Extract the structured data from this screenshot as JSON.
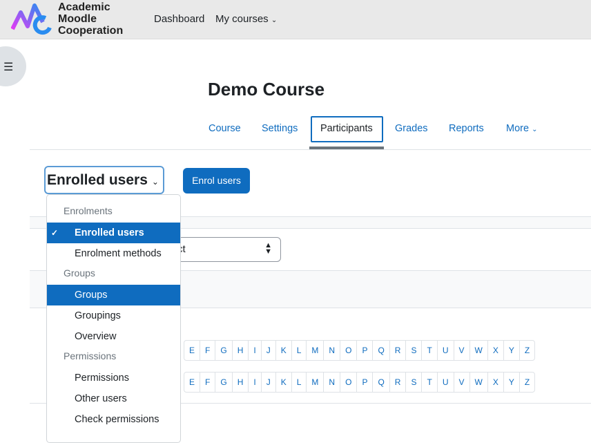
{
  "header": {
    "brand": [
      "Academic",
      "Moodle",
      "Cooperation"
    ],
    "nav": [
      "Dashboard",
      "My courses"
    ]
  },
  "course": {
    "title": "Demo Course"
  },
  "tabs": [
    "Course",
    "Settings",
    "Participants",
    "Grades",
    "Reports",
    "More"
  ],
  "selected_tab": "Participants",
  "page_select": {
    "value": "Enrolled users"
  },
  "enrol_button": "Enrol users",
  "filter_select": {
    "partial_value": "ct"
  },
  "letters": [
    "E",
    "F",
    "G",
    "H",
    "I",
    "J",
    "K",
    "L",
    "M",
    "N",
    "O",
    "P",
    "Q",
    "R",
    "S",
    "T",
    "U",
    "V",
    "W",
    "X",
    "Y",
    "Z"
  ],
  "dropdown": [
    {
      "type": "header",
      "label": "Enrolments"
    },
    {
      "type": "item",
      "label": "Enrolled users",
      "selected": true
    },
    {
      "type": "item",
      "label": "Enrolment methods"
    },
    {
      "type": "header",
      "label": "Groups"
    },
    {
      "type": "item",
      "label": "Groups",
      "highlighted": true
    },
    {
      "type": "item",
      "label": "Groupings"
    },
    {
      "type": "item",
      "label": "Overview"
    },
    {
      "type": "header",
      "label": "Permissions"
    },
    {
      "type": "item",
      "label": "Permissions"
    },
    {
      "type": "item",
      "label": "Other users"
    },
    {
      "type": "item",
      "label": "Check permissions"
    }
  ],
  "colors": {
    "accent": "#0f6cbf",
    "header_bg": "#e9e9e9"
  }
}
